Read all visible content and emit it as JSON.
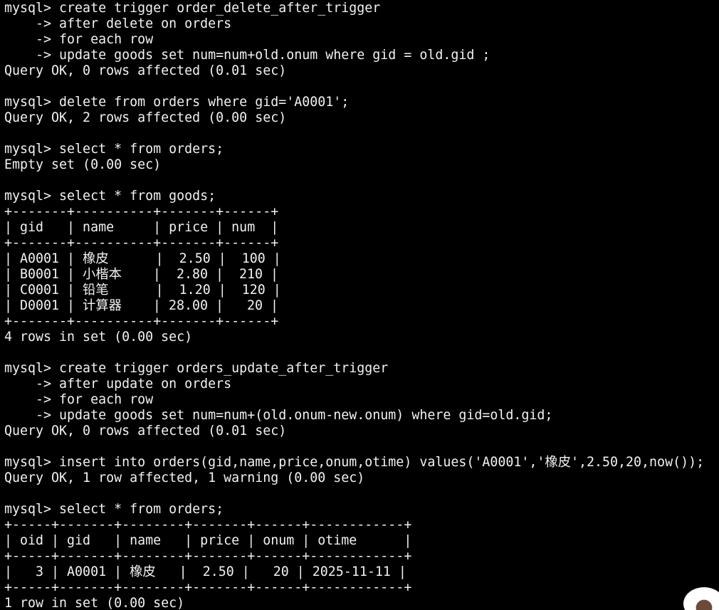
{
  "terminal": {
    "lines": [
      "mysql> create trigger order_delete_after_trigger",
      "    -> after delete on orders",
      "    -> for each row",
      "    -> update goods set num=num+old.onum where gid = old.gid ;",
      "Query OK, 0 rows affected (0.01 sec)",
      "",
      "mysql> delete from orders where gid='A0001';",
      "Query OK, 2 rows affected (0.00 sec)",
      "",
      "mysql> select * from orders;",
      "Empty set (0.00 sec)",
      "",
      "mysql> select * from goods;",
      "+-------+----------+-------+------+",
      "| gid   | name     | price | num  |",
      "+-------+----------+-------+------+",
      "| A0001 | 橡皮      |  2.50 |  100 |",
      "| B0001 | 小楷本    |  2.80 |  210 |",
      "| C0001 | 铅笔      |  1.20 |  120 |",
      "| D0001 | 计算器    | 28.00 |   20 |",
      "+-------+----------+-------+------+",
      "4 rows in set (0.00 sec)",
      "",
      "mysql> create trigger orders_update_after_trigger",
      "    -> after update on orders",
      "    -> for each row",
      "    -> update goods set num=num+(old.onum-new.onum) where gid=old.gid;",
      "Query OK, 0 rows affected (0.01 sec)",
      "",
      "mysql> insert into orders(gid,name,price,onum,otime) values('A0001','橡皮',2.50,20,now());",
      "Query OK, 1 row affected, 1 warning (0.00 sec)",
      "",
      "mysql> select * from orders;",
      "+-----+-------+--------+-------+------+------------+",
      "| oid | gid   | name   | price | onum | otime      |",
      "+-----+-------+--------+-------+------+------------+",
      "|   3 | A0001 | 橡皮   |  2.50 |   20 | 2025-11-11 |",
      "+-----+-------+--------+-------+------+------------+",
      "1 row in set (0.00 sec)"
    ]
  }
}
